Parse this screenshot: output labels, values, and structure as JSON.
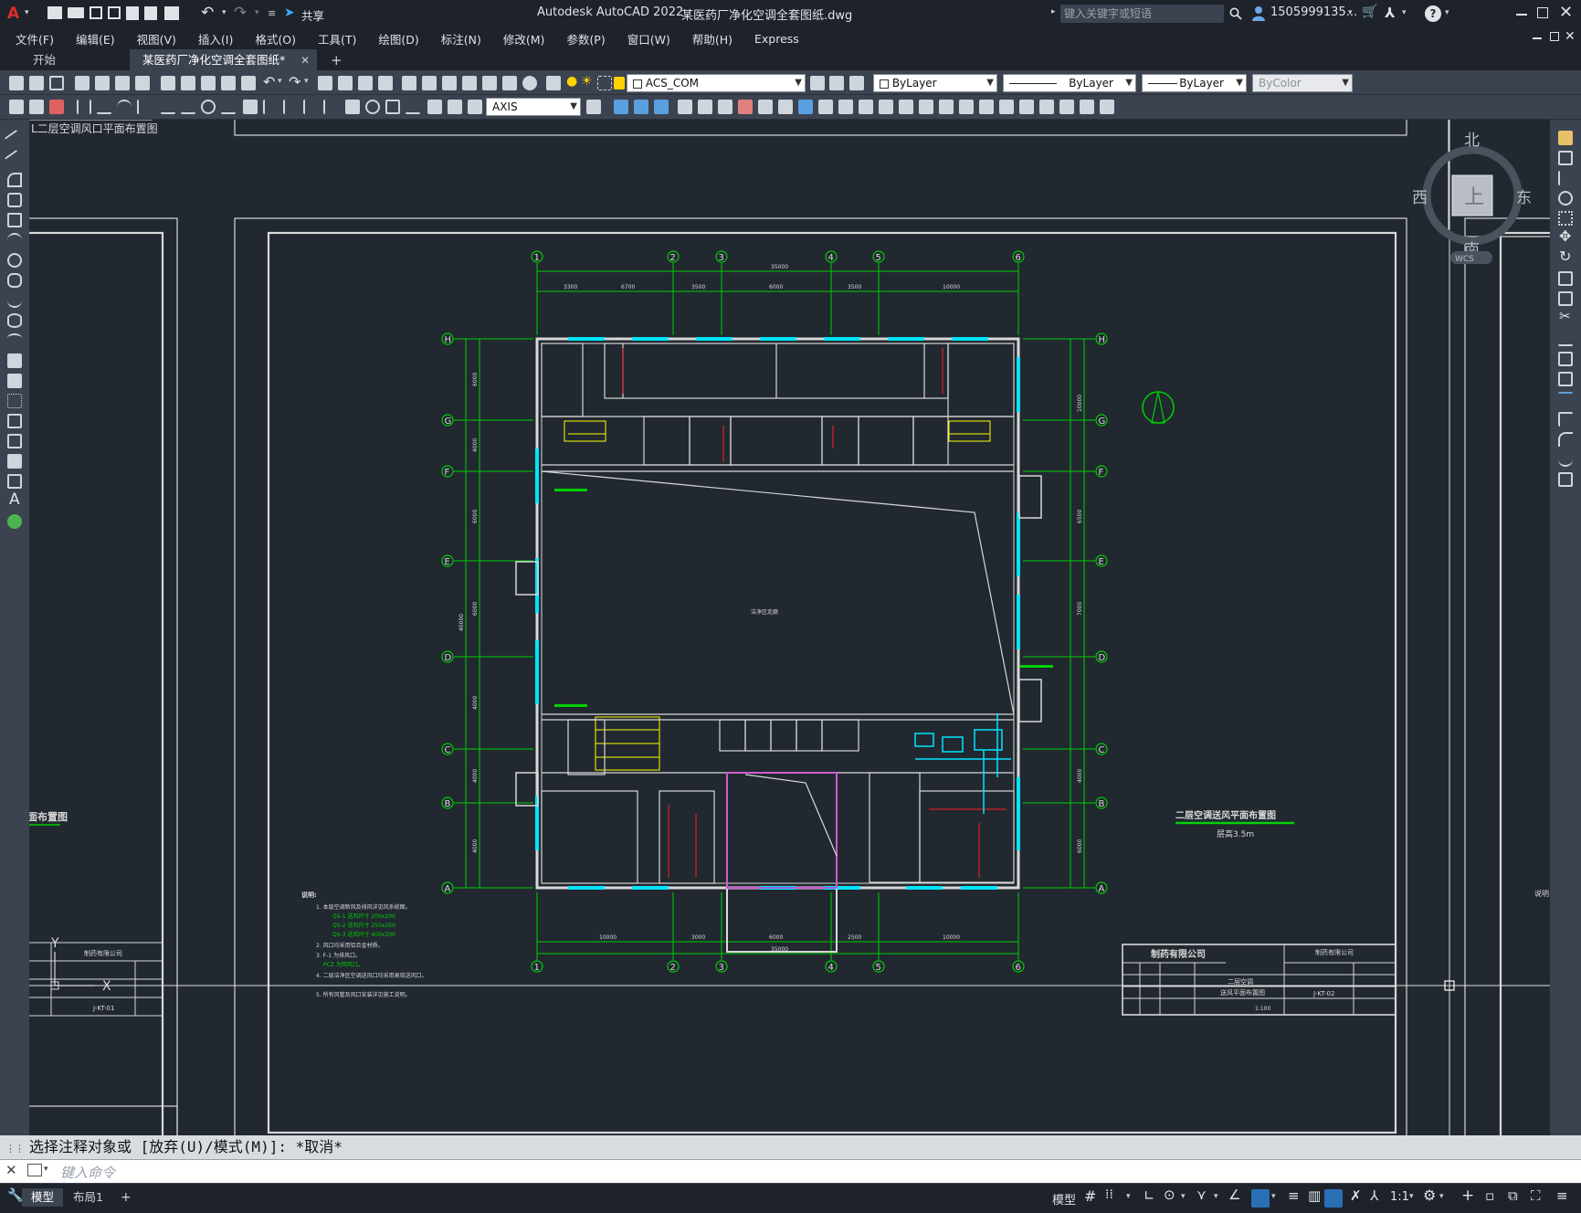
{
  "titlebar": {
    "share_label": "共享",
    "app_title": "Autodesk AutoCAD 2022",
    "file_name": "某医药厂净化空调全套图纸.dwg",
    "search_placeholder": "键入关键字或短语",
    "user_name": "1505999135...",
    "help_glyph": "?"
  },
  "menu": [
    "文件(F)",
    "编辑(E)",
    "视图(V)",
    "插入(I)",
    "格式(O)",
    "工具(T)",
    "绘图(D)",
    "标注(N)",
    "修改(M)",
    "参数(P)",
    "窗口(W)",
    "帮助(H)",
    "Express"
  ],
  "tabs": {
    "start": "开始",
    "document": "某医药厂净化空调全套图纸*",
    "add": "+"
  },
  "toolbar": {
    "layer_name": "ACS_COM",
    "color": "ByLayer",
    "linetype": "ByLayer",
    "lineweight": "ByLayer",
    "plotstyle": "ByColor",
    "dimstyle": "AXIS"
  },
  "viewcube": {
    "north": "北",
    "south": "南",
    "east": "东",
    "west": "西",
    "face": "上",
    "wcs": "WCS"
  },
  "ucs": {
    "x": "X",
    "y": "Y"
  },
  "drawing": {
    "left_sheet_header": "L二层空调风口平面布置图",
    "left_sheet_title": "面布置图",
    "right_sheet_label": "说明",
    "grid_numbers": [
      "1",
      "2",
      "3",
      "4",
      "5",
      "6"
    ],
    "grid_letters": [
      "H",
      "G",
      "F",
      "E",
      "D",
      "C",
      "B",
      "A"
    ],
    "top_overall_dim": "35000",
    "top_dims": [
      "3300",
      "6700",
      "3500",
      "6000",
      "3500",
      "10000"
    ],
    "bottom_overall_dim": "35000",
    "bottom_dims": [
      "10000",
      "3000",
      "6000",
      "2500",
      "10000"
    ],
    "left_overall_dim": "40000",
    "left_dims": [
      "6000",
      "4000",
      "6000",
      "6000",
      "4000",
      "4000",
      "4000"
    ],
    "right_dims": [
      "10000",
      "6500",
      "7000",
      "4000",
      "6000"
    ],
    "plan_title": "二层空调送风平面布置图",
    "plan_scale": "层高3.5m",
    "center_room": "洁净区走廊",
    "notes_title": "说明:",
    "notes": [
      "1. 本层空调新风及排风详见风系统图。",
      "QS-1 送风尺寸 200x200",
      "QS-2 送风尺寸 250x250",
      "QS-3 送风尺寸 400x200",
      "2. 风口均采用铝合金材质。",
      "3. F-1 为排风口。",
      "PCZ 为回风口。",
      "4. 二层洁净区空调送风口均采用高效送风口。",
      "5. 所有风管及风口安装详见施工说明。"
    ],
    "company": "制药有限公司",
    "sheet_no": "J-KT-02",
    "left_sheet_no": "J-KT-01",
    "drawing_name_1": "二层空调",
    "drawing_name_2": "送风平面布置图",
    "scale_text": "1:100"
  },
  "command": {
    "history": "选择注释对象或 [放弃(U)/模式(M)]: *取消*",
    "placeholder": "键入命令"
  },
  "status": {
    "model_tab": "模型",
    "layout_tab": "布局1",
    "add": "+",
    "model_label": "模型",
    "scale": "1:1"
  },
  "colors": {
    "background": "#212830",
    "wall": "#d8d8d8",
    "window": "#00e5ff",
    "gridline": "#00d000",
    "annotation": "#ffff00",
    "duct": "#ff2020"
  }
}
